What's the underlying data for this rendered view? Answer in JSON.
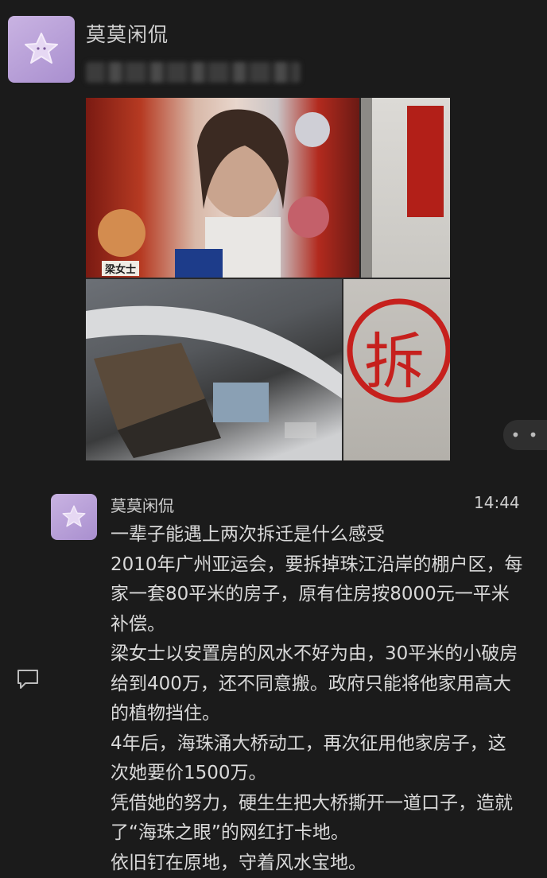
{
  "post": {
    "author": "莫莫闲侃",
    "image_caption_tag": "梁女士",
    "demolish_mark": "拆"
  },
  "comment": {
    "author": "莫莫闲侃",
    "time": "14:44",
    "lines": [
      "一辈子能遇上两次拆迁是什么感受",
      "2010年广州亚运会，要拆掉珠江沿岸的棚户区，每家一套80平米的房子，原有住房按8000元一平米补偿。",
      "梁女士以安置房的风水不好为由，30平米的小破房给到400万，还不同意搬。政府只能将他家用高大的植物挡住。",
      "4年后，海珠涌大桥动工，再次征用他家房子，这次她要价1500万。",
      "凭借她的努力，硬生生把大桥撕开一道口子，造就了“海珠之眼”的网红打卡地。",
      "依旧钉在原地，守着风水宝地。"
    ]
  },
  "more_button": "• •",
  "icons": [
    "avatar-star-icon",
    "more-icon",
    "comment-icon"
  ]
}
